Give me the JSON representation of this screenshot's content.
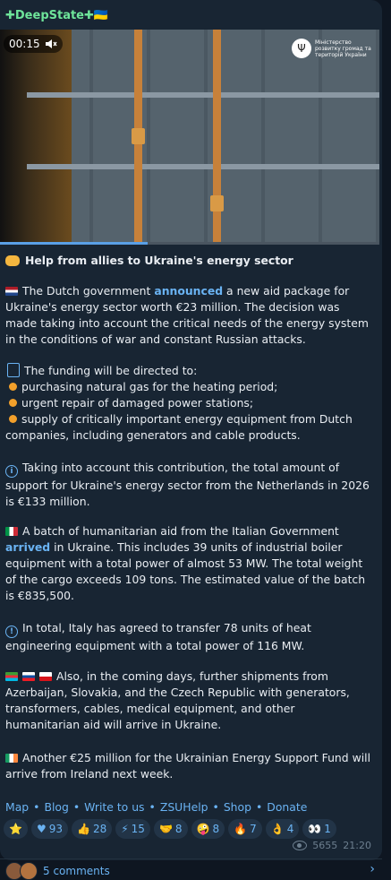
{
  "channel": {
    "name": "✚DeepState✚🇺🇦"
  },
  "video": {
    "time": "00:15",
    "ministry_text": "Міністерство розвитку громад та територій України",
    "progress_fraction": 0.39
  },
  "post": {
    "heading": "Help from allies to Ukraine's energy sector",
    "p1_a": "The Dutch government ",
    "p1_link": "announced",
    "p1_b": " a new aid package for Ukraine's energy sector worth €23 million. The decision was made taking into account the critical needs of the energy system in the conditions of war and constant Russian attacks.",
    "p2_intro": "The funding will be directed to:",
    "p2_items": [
      "purchasing natural gas for the heating period;",
      "urgent repair of damaged power stations;",
      "supply of critically important energy equipment from Dutch companies, including generators and cable products."
    ],
    "p3": "Taking into account this contribution, the total amount of support for Ukraine's energy sector from the Netherlands in 2026 is €133 million.",
    "p4_a": "A batch of humanitarian aid from the Italian Government ",
    "p4_link": "arrived",
    "p4_b": " in Ukraine. This includes 39 units of industrial boiler equipment with a total power of almost 53 MW. The total weight of the cargo exceeds 109 tons. The estimated value of the batch is €835,500.",
    "p5": "In total, Italy has agreed to transfer 78 units of heat engineering equipment with a total power of 116 MW.",
    "p6": "Also, in the coming days, further shipments from Azerbaijan, Slovakia, and the Czech Republic with generators, transformers, cables, medical equipment, and other humanitarian aid will arrive in Ukraine.",
    "p7": "Another €25 million for the Ukrainian Energy Support Fund will arrive from Ireland next week."
  },
  "links": [
    "Map",
    "Blog",
    "Write to us",
    "ZSUHelp",
    "Shop",
    "Donate"
  ],
  "reactions": [
    {
      "icon": "⭐",
      "icon_name": "star-icon",
      "count": ""
    },
    {
      "icon": "♥",
      "icon_name": "heart-icon",
      "count": "93"
    },
    {
      "icon": "👍",
      "icon_name": "thumbs-up-icon",
      "count": "28"
    },
    {
      "icon": "⚡",
      "icon_name": "lightning-icon",
      "count": "15"
    },
    {
      "icon": "🤝",
      "icon_name": "handshake-icon",
      "count": "8"
    },
    {
      "icon": "🤪",
      "icon_name": "crazy-face-icon",
      "count": "8"
    },
    {
      "icon": "🔥",
      "icon_name": "fire-icon",
      "count": "7"
    },
    {
      "icon": "👌",
      "icon_name": "ok-hand-icon",
      "count": "4"
    },
    {
      "icon": "👀",
      "icon_name": "eyes-icon",
      "count": "1"
    }
  ],
  "meta": {
    "views": "5655",
    "time": "21:20"
  },
  "comments": {
    "label": "5 comments"
  },
  "colors": {
    "bg": "#0e1621",
    "bubble": "#182533",
    "link": "#6ab3f3",
    "channel": "#6ee49a"
  }
}
